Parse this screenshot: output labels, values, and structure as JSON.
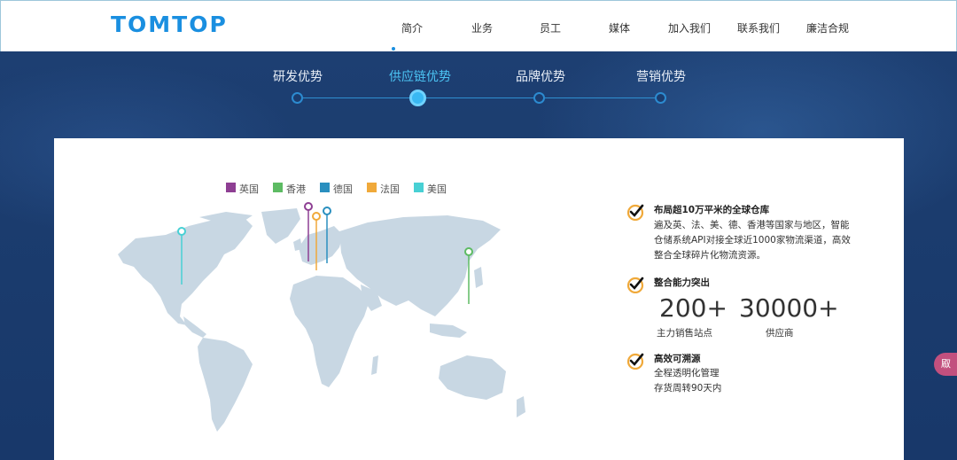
{
  "header": {
    "logo": "TOMTOP",
    "nav": [
      "简介",
      "业务",
      "员工",
      "媒体",
      "加入我们",
      "联系我们",
      "廉洁合规"
    ]
  },
  "tabs": [
    "研发优势",
    "供应链优势",
    "品牌优势",
    "营销优势"
  ],
  "active_tab": "供应链优势",
  "legend": [
    {
      "label": "英国",
      "color": "#8e3f93"
    },
    {
      "label": "香港",
      "color": "#5dbb63"
    },
    {
      "label": "德国",
      "color": "#2a8fbf"
    },
    {
      "label": "法国",
      "color": "#f0a93a"
    },
    {
      "label": "美国",
      "color": "#48d0d4"
    }
  ],
  "features": {
    "f1": {
      "title": "布局超10万平米的全球仓库",
      "lines": [
        "遍及英、法、美、德、香港等国家与地区，智能",
        "仓储系统API对接全球近1000家物流渠道，高效",
        "整合全球碎片化物流资源。"
      ]
    },
    "f2": {
      "title": "整合能力突出",
      "stat1_value": "200+",
      "stat1_label": "主力销售站点",
      "stat2_value": "30000+",
      "stat2_label": "供应商"
    },
    "f3": {
      "title": "高效可溯源",
      "lines": [
        "全程透明化管理",
        "存货周转90天内"
      ]
    }
  },
  "side_widget": "㕞"
}
